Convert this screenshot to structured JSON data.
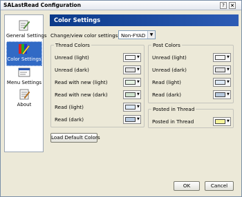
{
  "window": {
    "title": "SALastRead Configuration",
    "help_glyph": "?",
    "close_glyph": "×"
  },
  "sidebar": {
    "items": [
      {
        "label": "General Settings",
        "icon": "general-settings-icon"
      },
      {
        "label": "Color Settings",
        "icon": "color-settings-icon",
        "selected": true
      },
      {
        "label": "Menu Settings",
        "icon": "menu-settings-icon"
      },
      {
        "label": "About",
        "icon": "about-icon"
      }
    ]
  },
  "header": {
    "title": "Color Settings"
  },
  "color_set": {
    "label": "Change/view color settings for:",
    "value": "Non-FYAD"
  },
  "thread_colors": {
    "title": "Thread Colors",
    "items": [
      {
        "label": "Unread (light)",
        "color": "#f4f4f4"
      },
      {
        "label": "Unread (dark)",
        "color": "#e2e2e2"
      },
      {
        "label": "Read with new (light)",
        "color": "#e4f2e2"
      },
      {
        "label": "Read with new (dark)",
        "color": "#cfe3cf"
      },
      {
        "label": "Read (light)",
        "color": "#dde9f6"
      },
      {
        "label": "Read (dark)",
        "color": "#b7c9de"
      }
    ]
  },
  "post_colors": {
    "title": "Post Colors",
    "items": [
      {
        "label": "Unread (light)",
        "color": "#f4f4f4"
      },
      {
        "label": "Unread (dark)",
        "color": "#e2e2e2"
      },
      {
        "label": "Read (light)",
        "color": "#dde9f6"
      },
      {
        "label": "Read (dark)",
        "color": "#b7c9de"
      }
    ]
  },
  "posted_in_thread": {
    "title": "Posted in Thread",
    "items": [
      {
        "label": "Posted in Thread",
        "color": "#f6f49a"
      }
    ]
  },
  "buttons": {
    "load_defaults": "Load Default Colors",
    "ok": "OK",
    "cancel": "Cancel"
  },
  "dropdown_arrow": "▼"
}
